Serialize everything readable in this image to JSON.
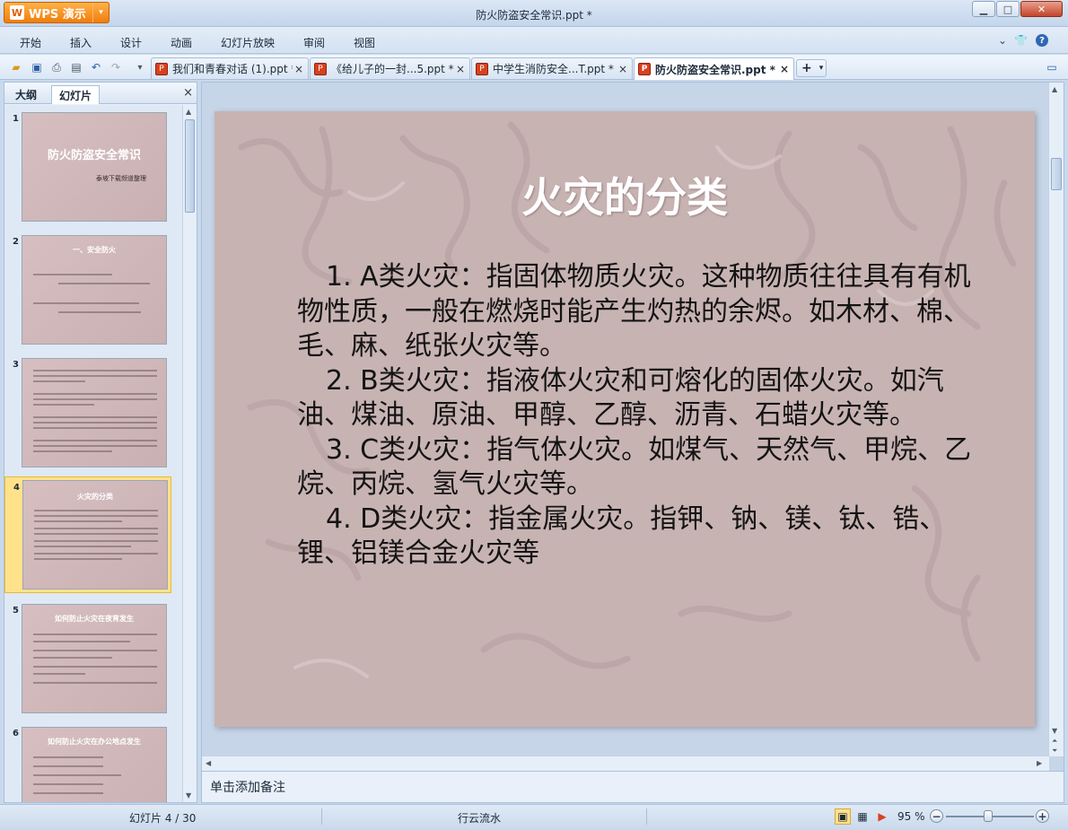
{
  "app": {
    "button_label": "WPS 演示",
    "window_title": "防火防盗安全常识.ppt *"
  },
  "window_controls": {
    "minimize": "▁",
    "maximize": "□",
    "close": "✕"
  },
  "menu": [
    "开始",
    "插入",
    "设计",
    "动画",
    "幻灯片放映",
    "审阅",
    "视图"
  ],
  "menu_right": {
    "expand": "⌄",
    "skin": "👕",
    "help": "?"
  },
  "tabs": [
    {
      "label": "我们和青春对话 (1).ppt *"
    },
    {
      "label": "《给儿子的一封...5.ppt *"
    },
    {
      "label": "中学生消防安全...T.ppt *"
    },
    {
      "label": "防火防盗安全常识.ppt *"
    }
  ],
  "tab_close": "×",
  "tab_add": "+",
  "panel": {
    "tabs": [
      "大纲",
      "幻灯片"
    ],
    "close": "×"
  },
  "slides": [
    {
      "number": "1",
      "title": "防火防盗安全常识",
      "subtitle": "泰坡下载频道整理"
    },
    {
      "number": "2",
      "title": "一、安全防火"
    },
    {
      "number": "3"
    },
    {
      "number": "4",
      "title": "火灾的分类"
    },
    {
      "number": "5",
      "title": "如何防止火灾在夜宵发生"
    },
    {
      "number": "6",
      "title": "如何防止火灾在办公地点发生"
    }
  ],
  "current_slide": {
    "title": "火灾的分类",
    "body": [
      "1. A类火灾：指固体物质火灾。这种物质往往具有有机物性质，一般在燃烧时能产生灼热的余烬。如木材、棉、毛、麻、纸张火灾等。",
      "2. B类火灾：指液体火灾和可熔化的固体火灾。如汽油、煤油、原油、甲醇、乙醇、沥青、石蜡火灾等。",
      "3. C类火灾：指气体火灾。如煤气、天然气、甲烷、乙烷、丙烷、氢气火灾等。",
      "4. D类火灾：指金属火灾。指钾、钠、镁、钛、锆、锂、铝镁合金火灾等"
    ]
  },
  "notes_placeholder": "单击添加备注",
  "status": {
    "slide_counter": "幻灯片 4 / 30",
    "theme": "行云流水",
    "zoom": "95 %",
    "zoom_level_percent": 95
  }
}
